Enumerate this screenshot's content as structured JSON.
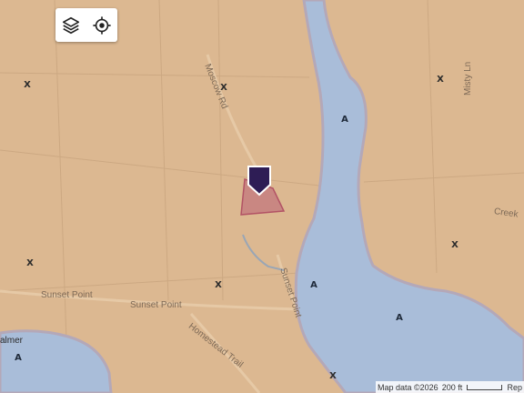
{
  "colors": {
    "land": "#dcb891",
    "water": "#a9bdd9",
    "water_edge": "#b4a8b8",
    "parcel_fill": "#c98582",
    "parcel_stroke": "#b04e63",
    "pin": "#2e1d55",
    "controls_bg": "#ffffff"
  },
  "controls": {
    "layers_icon": "layers-icon",
    "locate_icon": "locate-icon"
  },
  "roads": {
    "moscow_rd": "Moscow Rd",
    "misty_ln": "Misty Ln",
    "creek": "Creek",
    "sunset_point_1": "Sunset Point",
    "sunset_point_2": "Sunset Point",
    "sunset_point_3": "Sunset Point",
    "homestead_trail": "Homestead Trail",
    "palmer_partial": "almer"
  },
  "markers": {
    "x": "X",
    "a": "A"
  },
  "attribution": {
    "map_data": "Map data ©2026",
    "scale": "200 ft",
    "report": "Rep"
  }
}
